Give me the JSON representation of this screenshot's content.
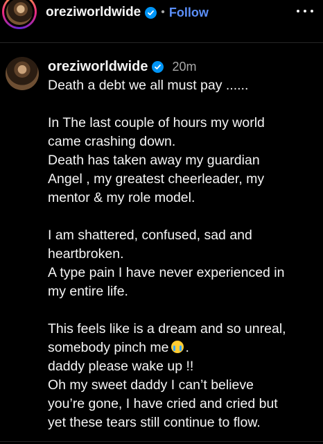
{
  "header": {
    "username": "oreziworldwide",
    "separator": "•",
    "follow_label": "Follow"
  },
  "post": {
    "username": "oreziworldwide",
    "time": "20m",
    "caption": {
      "l1": "Death a debt we all must pay ......",
      "l2": "In The last couple of hours my world",
      "l3": "came crashing down.",
      "l4": "Death has taken away my guardian",
      "l5": "Angel , my greatest cheerleader, my",
      "l6": "mentor & my role model.",
      "l7": "I am shattered, confused, sad and",
      "l8": "heartbroken.",
      "l9": "A type pain I have never experienced in",
      "l10": "my entire life.",
      "l11": "This feels like is a dream and so unreal,",
      "l12": "somebody pinch me",
      "l12_after": ".",
      "l13": "daddy please wake up !!",
      "l14": "Oh my sweet daddy I can’t believe",
      "l15": "you’re gone, I have cried and cried but",
      "l16": "yet these tears still continue to flow."
    }
  },
  "icons": {
    "verified": "verified-badge-icon",
    "more": "more-options-icon",
    "emoji": "crying-face-emoji"
  },
  "colors": {
    "background": "#000000",
    "text": "#f5f5f5",
    "secondary": "#a8a8a8",
    "link": "#5b8ff9",
    "verified": "#0095f6"
  }
}
